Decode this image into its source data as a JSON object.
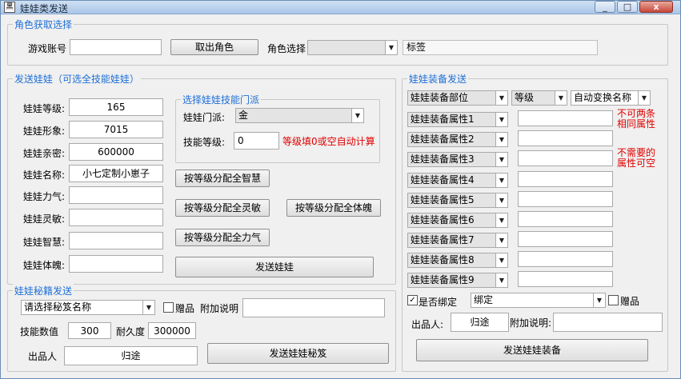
{
  "window": {
    "title": "娃娃类发送",
    "icon": "黑",
    "min_label": "_",
    "max_label": "□",
    "close_label": "x"
  },
  "role_section": {
    "legend": "角色获取选择",
    "account_label": "游戏账号",
    "account_value": "",
    "fetch_button": "取出角色",
    "role_select_label": "角色选择",
    "role_select_value": "",
    "tag_label": "标签"
  },
  "doll_section": {
    "legend": "发送娃娃（可选全技能娃娃）",
    "fields": [
      {
        "label": "娃娃等级:",
        "value": "165"
      },
      {
        "label": "娃娃形象:",
        "value": "7015"
      },
      {
        "label": "娃娃亲密:",
        "value": "600000"
      },
      {
        "label": "娃娃名称:",
        "value": "小七定制小崽子"
      },
      {
        "label": "娃娃力气:",
        "value": ""
      },
      {
        "label": "娃娃灵敏:",
        "value": ""
      },
      {
        "label": "娃娃智慧:",
        "value": ""
      },
      {
        "label": "娃娃体魄:",
        "value": ""
      }
    ],
    "sub_legend": "选择娃娃技能门派",
    "school_label": "娃娃门派:",
    "school_value": "金",
    "skill_level_label": "技能等级:",
    "skill_level_value": "0",
    "skill_hint": "等级填0或空自动计算",
    "btn_wisdom": "按等级分配全智慧",
    "btn_agility": "按等级分配全灵敏",
    "btn_body": "按等级分配全体魄",
    "btn_strength": "按等级分配全力气",
    "send_button": "发送娃娃"
  },
  "secret_section": {
    "legend": "娃娃秘籍发送",
    "select_value": "请选择秘笈名称",
    "gift_label": "赠品",
    "note_label": "附加说明",
    "note_value": "",
    "skill_value_label": "技能数值",
    "skill_value": "300",
    "durability_label": "耐久度",
    "durability_value": "300000",
    "producer_label": "出品人",
    "producer_value": "归途",
    "send_button": "发送娃娃秘笈"
  },
  "equip_section": {
    "legend": "娃娃装备发送",
    "part_value": "娃娃装备部位",
    "level_value": "等级",
    "auto_name_value": "自动变换名称",
    "attributes": [
      {
        "label": "娃娃装备属性1",
        "value": ""
      },
      {
        "label": "娃娃装备属性2",
        "value": ""
      },
      {
        "label": "娃娃装备属性3",
        "value": ""
      },
      {
        "label": "娃娃装备属性4",
        "value": ""
      },
      {
        "label": "娃娃装备属性5",
        "value": ""
      },
      {
        "label": "娃娃装备属性6",
        "value": ""
      },
      {
        "label": "娃娃装备属性7",
        "value": ""
      },
      {
        "label": "娃娃装备属性8",
        "value": ""
      },
      {
        "label": "娃娃装备属性9",
        "value": ""
      }
    ],
    "note1_line1": "不可两条",
    "note1_line2": "相同属性",
    "note2_line1": "不需要的",
    "note2_line2": "属性可空",
    "bind_label": "是否绑定",
    "bind_value": "绑定",
    "gift_label": "赠品",
    "producer_label": "出品人:",
    "producer_value": "归途",
    "note_label": "附加说明:",
    "note_value": "",
    "send_button": "发送娃娃装备"
  }
}
